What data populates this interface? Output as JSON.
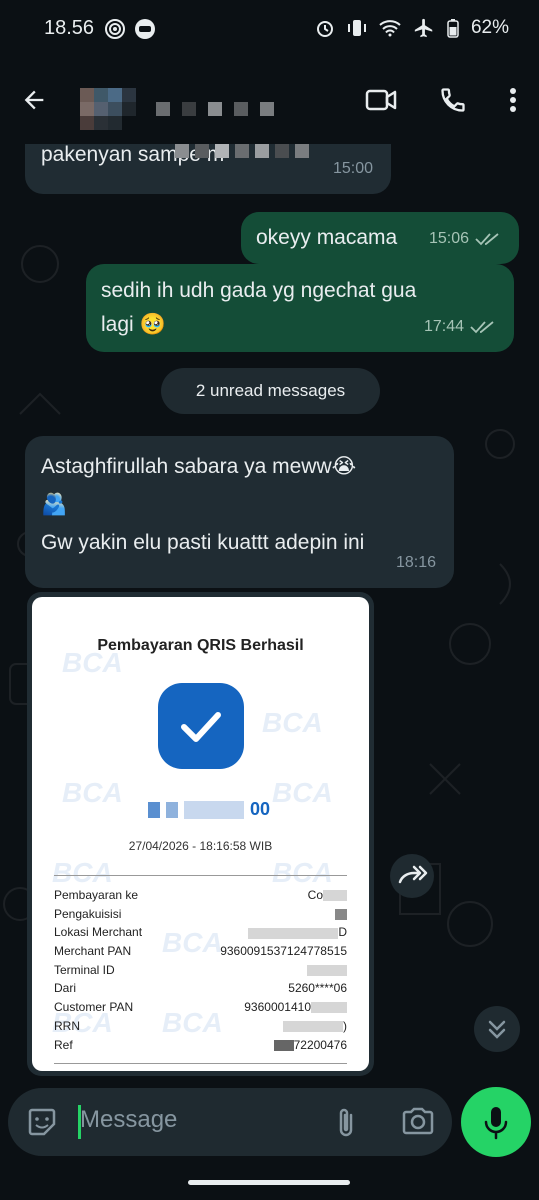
{
  "status_bar": {
    "time": "18.56",
    "battery": "62%"
  },
  "header": {
    "back_icon": "arrow-left-icon",
    "contact_name_blurred": true
  },
  "messages": [
    {
      "direction": "in",
      "text": "pakenyan sampe m",
      "time": "15:00"
    },
    {
      "direction": "out",
      "text": "okeyy macama",
      "time": "15:06",
      "status": "read"
    },
    {
      "direction": "out",
      "text_line1": "sedih ih udh gada yg ngechat gua",
      "text_line2": "lagi 🥹",
      "time": "17:44",
      "status": "read"
    },
    {
      "direction": "in",
      "text_line1": "Astaghfirullah sabara ya meww😭",
      "text_line2": "🫂",
      "text_line3": "Gw yakin elu pasti kuattt adepin ini",
      "time": "18:16"
    }
  ],
  "unread_label": "2 unread messages",
  "receipt": {
    "watermark": "BCA",
    "title": "Pembayaran QRIS Berhasil",
    "amount_suffix": "00",
    "datetime": "27/04/2026 - 18:16:58 WIB",
    "rows": [
      {
        "label": "Pembayaran ke",
        "value": "Co"
      },
      {
        "label": "Pengakuisisi",
        "value": ""
      },
      {
        "label": "Lokasi Merchant",
        "value": "D"
      },
      {
        "label": "Merchant PAN",
        "value": "9360091537124778515"
      },
      {
        "label": "Terminal ID",
        "value": ""
      },
      {
        "label": "Dari",
        "value": "5260****06"
      },
      {
        "label": "Customer PAN",
        "value": "9360001410"
      },
      {
        "label": "RRN",
        "value": ")"
      },
      {
        "label": "Ref",
        "value": "72200476"
      }
    ]
  },
  "composer": {
    "placeholder": "Message"
  },
  "colors": {
    "bg": "#0b1014",
    "incoming": "#202c33",
    "outgoing": "#144d37",
    "accent": "#25d366",
    "bca_blue": "#1565c0"
  }
}
